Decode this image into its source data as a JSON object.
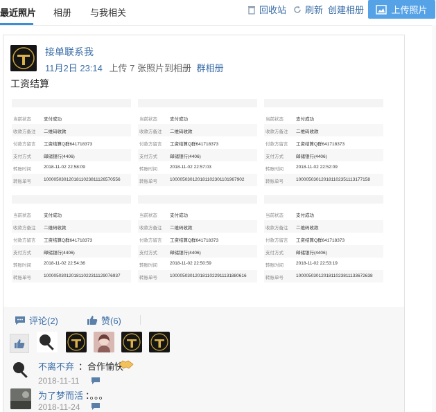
{
  "tabs": [
    {
      "label": "最近照片",
      "active": true
    },
    {
      "label": "相册",
      "active": false
    },
    {
      "label": "与我相关",
      "active": false
    }
  ],
  "toolbar": {
    "recycle": "回收站",
    "refresh": "刷新",
    "create_album": "创建相册",
    "upload": "上传照片"
  },
  "post": {
    "poster": "接单联系我",
    "time": "11月2日 23:14",
    "action": "上传 7 张照片到相册",
    "album": "群相册",
    "caption": "工资结算"
  },
  "receipt_labels": [
    "当前状态",
    "收款方备注",
    "付款方留言",
    "支付方式",
    "转账时间",
    "转账单号"
  ],
  "receipts": [
    {
      "status": "支付成功",
      "note": "二维码收款",
      "message": "工资结算Q群641718373",
      "method": "邮储银行(4406)",
      "time": "2018-11-02 22:58:09",
      "order": "100005030120181102381112657​0556"
    },
    {
      "status": "支付成功",
      "note": "二维码收款",
      "message": "工资结算Q群641718373",
      "method": "邮储银行(4406)",
      "time": "2018-11-02 22:57:03",
      "order": "1000050301201811023011019679​02"
    },
    {
      "status": "支付成功",
      "note": "二维码收款",
      "message": "工资结算Q群641718373",
      "method": "邮储银行(4406)",
      "time": "2018-11-02 22:52:09",
      "order": "1000050301201811023511131771​58"
    },
    {
      "status": "支付成功",
      "note": "二维码收款",
      "message": "工资结算Q群641718373",
      "method": "邮储银行(4406)",
      "time": "2018-11-02 22:54:36",
      "order": "1000050301201811022311129076​937"
    },
    {
      "status": "支付成功",
      "note": "二维码收款",
      "message": "工资结算Q群641718373",
      "method": "邮储银行(4406)",
      "time": "2018-11-02 22:50:59",
      "order": "1000050301201811022911131880​616"
    },
    {
      "status": "支付成功",
      "note": "二维码收款",
      "message": "工资结算Q群641718373",
      "method": "邮储银行(4406)",
      "time": "2018-11-02 22:53:19",
      "order": "1000050301201811023811133672​638"
    }
  ],
  "actions": {
    "comment": "评论(2)",
    "like": "赞(6)"
  },
  "comments": [
    {
      "name": "不离不弃",
      "text": "：合作愉快",
      "date": "2018-11-11"
    },
    {
      "name": "为了梦而活",
      "text": "：。。。",
      "date": "2018-11-24"
    }
  ],
  "colors": {
    "link": "#3b6ea8",
    "upload_button": "#55a2e7",
    "tab_underline": "#3b8fd8"
  }
}
